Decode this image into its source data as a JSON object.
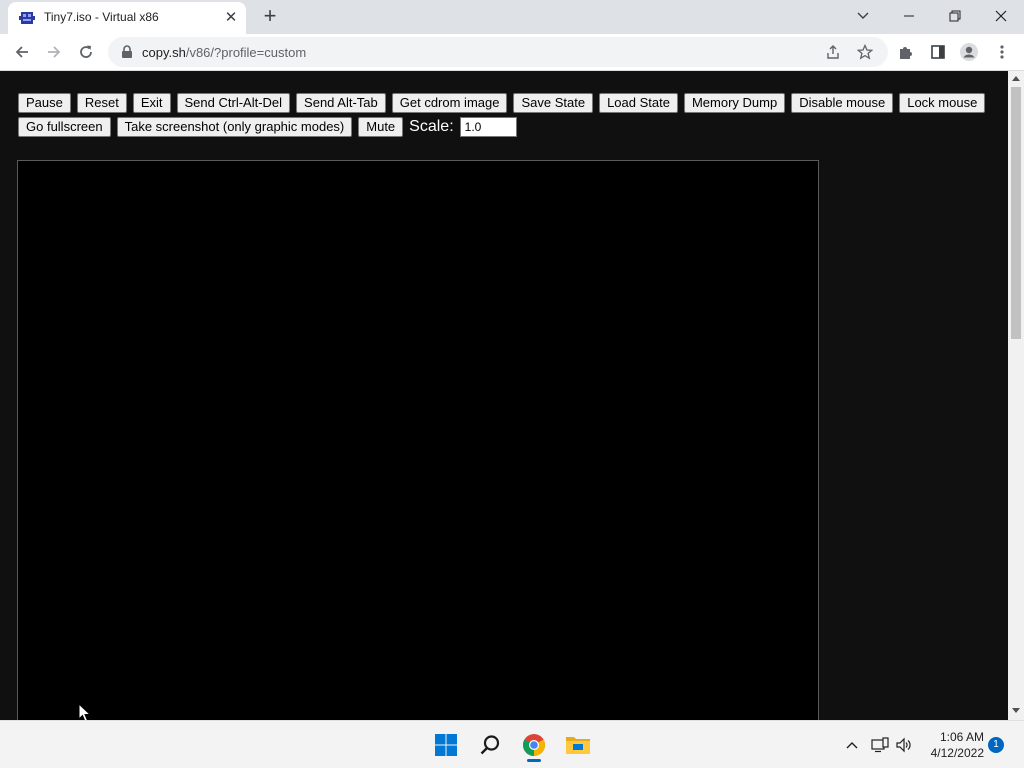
{
  "browser": {
    "tab": {
      "title": "Tiny7.iso - Virtual x86",
      "close": "✕"
    },
    "new_tab": "+",
    "url": {
      "host": "copy.sh",
      "path": "/v86/?profile=custom"
    }
  },
  "controls": {
    "row1": [
      "Pause",
      "Reset",
      "Exit",
      "Send Ctrl-Alt-Del",
      "Send Alt-Tab",
      "Get cdrom image",
      "Save State",
      "Load State",
      "Memory Dump",
      "Disable mouse",
      "Lock mouse"
    ],
    "row2": [
      "Go fullscreen",
      "Take screenshot (only graphic modes)",
      "Mute"
    ],
    "scale_label": "Scale:",
    "scale_value": "1.0"
  },
  "taskbar": {
    "time": "1:06 AM",
    "date": "4/12/2022",
    "notifications": "1"
  },
  "colors": {
    "page_bg": "#101010",
    "screen_bg": "#000000",
    "accent": "#0067c0"
  }
}
